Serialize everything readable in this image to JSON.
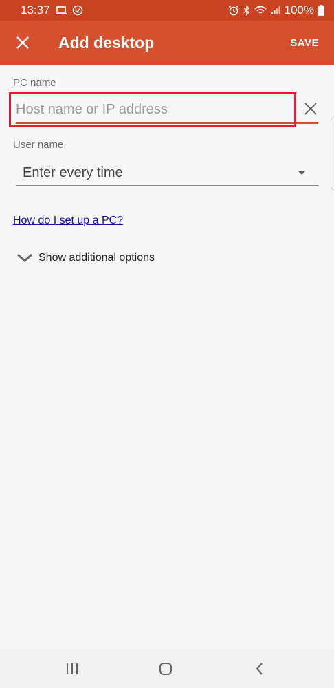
{
  "status_bar": {
    "time": "13:37",
    "battery": "100%"
  },
  "app_bar": {
    "title": "Add desktop",
    "save_label": "SAVE"
  },
  "form": {
    "pc_name": {
      "label": "PC name",
      "placeholder": "Host name or IP address",
      "value": ""
    },
    "user_name": {
      "label": "User name",
      "value": "Enter every time"
    },
    "help_link": "How do I set up a PC?",
    "additional_options_label": "Show additional options"
  },
  "colors": {
    "status_bar": "#c94323",
    "app_bar": "#d4502e",
    "highlight": "#e21d2b",
    "link": "#1a0dab"
  }
}
